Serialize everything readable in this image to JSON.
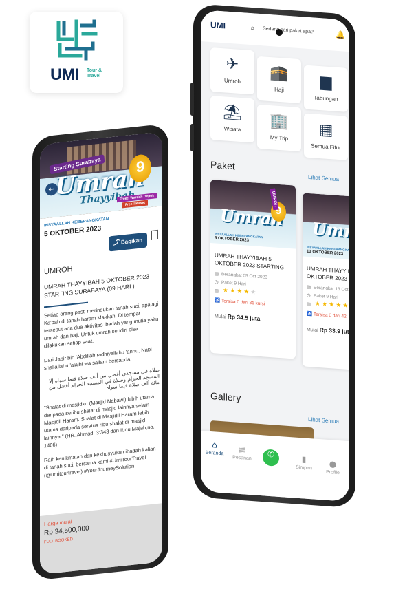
{
  "logo": {
    "name": "UMI",
    "sub": "Tour & Travel"
  },
  "detail": {
    "banner": {
      "ribbon": "Starting Surabaya",
      "title": "Umrah",
      "title2": "Thayyibah",
      "days": "9",
      "tag1": "Free!! Wardah Depok",
      "tag2": "Free!! Kaset"
    },
    "back_icon": "←",
    "depart_label": "INSYAALLAH KEBERANGKATAN",
    "depart_date": "5 OKTOBER 2023",
    "share_label": "Bagikan",
    "category": "UMROH",
    "title": "UMRAH THAYYIBAH 5 OKTOBER 2023 STARTING SURABAYA  (09 HARI )",
    "paragraphs": [
      "Setiap orang pasti merindukan tanah suci, apalagi Ka'bah di tanah haram Makkah. Di tempat tersebut ada dua aktivitas ibadah yang mulia yaitu umrah dan haji. Untuk umrah sendiri bisa dilakukan setiap saat.",
      "Dari Jabir bin 'Abdillah radhiyallahu 'anhu, Nabi shallallahu 'alaihi wa sallam bersabda,",
      "صلاة في مسجدي أفضل من ألف صلاة فيما سواه إلا المسجد الحرام وصلاة في المسجد الحرام أفضل من مائة ألف صلاة فيما سواه",
      "\"Shalat di masjidku (Masjid Nabawi) lebih utama daripada seribu shalat di masjid lainnya selain Masjidil Haram. Shalat di Masjidil Haram lebih utama daripada seratus ribu shalat di masjid lainnya.\" (HR. Ahmad, 3:343 dan Ibnu Majah,no. 1406)",
      "Raih kenikmatan dan kekhusyukan ibadah kalian di tanah suci, bersama kami #UmiTourTravel (@umitourtravel) #YourJourneySolution"
    ],
    "price_label": "Harga mulai",
    "price_value": "Rp 34,500,000",
    "status": "FULL BOOKED"
  },
  "home": {
    "search_placeholder": "Sedang cari paket apa?",
    "menu": [
      {
        "label": "Umroh",
        "icon": "✈"
      },
      {
        "label": "Haji",
        "icon": "🕋"
      },
      {
        "label": "Tabungan",
        "icon": "▆"
      },
      {
        "label": "Wisata",
        "icon": "⛱"
      },
      {
        "label": "My Trip",
        "icon": "🏢"
      },
      {
        "label": "Semua Fitur",
        "icon": "▦"
      }
    ],
    "paket_title": "Paket",
    "see_all": "Lihat Semua",
    "packages": [
      {
        "name": "UMRAH THAYYIBAH 5 OKTOBER 2023 STARTING",
        "date_label": "INSYAALLAH KEBERANGKATAN",
        "date": "5 OKTOBER 2023",
        "depart": "Berangkat 05 Oct 2023",
        "duration": "Paket 9 Hari",
        "rating": 4,
        "availability": "Tersisa 0 dari 31 kursi",
        "price_prefix": "Mulai",
        "price": "Rp 34.5 juta",
        "corner": "UMROH"
      },
      {
        "name": "UMRAH THAYYIBAH 13 OKTOBER 2023 (",
        "date_label": "INSYAALLAH KEBERANGKATAN",
        "date": "13 OKTOBER 2023",
        "depart": "Berangkat 13 Oct",
        "duration": "Paket 9 Hari",
        "rating": 5,
        "availability": "Tersisa 0 dari 42",
        "price_prefix": "Mulai",
        "price": "Rp 33.9 juta",
        "corner": ""
      }
    ],
    "gallery_title": "Gallery",
    "gallery_see_all": "Lihat Semua",
    "nav": [
      {
        "label": "Beranda",
        "icon": "⌂",
        "active": true
      },
      {
        "label": "Pesanan",
        "icon": "▤",
        "active": false
      },
      {
        "label": "",
        "icon": "✆",
        "active": false
      },
      {
        "label": "Simpan",
        "icon": "▮",
        "active": false
      },
      {
        "label": "Profile",
        "icon": "●",
        "active": false
      }
    ]
  },
  "colors": {
    "primary": "#1f4f7b",
    "accent": "#2a7bb6",
    "alert": "#e0503a",
    "star": "#f5b800"
  }
}
